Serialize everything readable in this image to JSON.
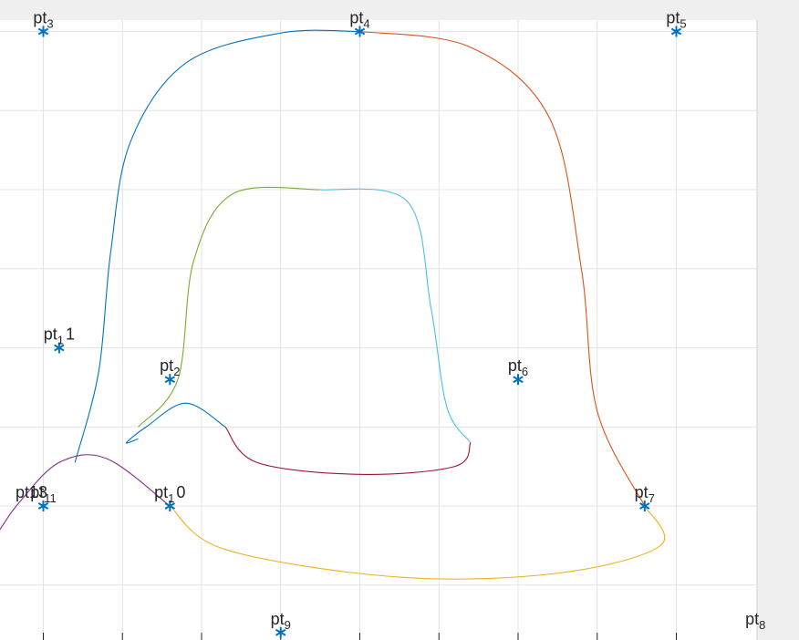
{
  "chart_data": {
    "type": "line",
    "title": "",
    "xlabel": "",
    "ylabel": "",
    "grid": true,
    "xlim": [
      -0.5,
      8.5
    ],
    "ylim": [
      -0.8,
      7.3
    ],
    "x_ticks": [
      0,
      1,
      2,
      3,
      4,
      5,
      6,
      7,
      8
    ],
    "y_ticks": [
      0,
      1,
      2,
      3,
      4,
      5,
      6,
      7
    ],
    "colors": {
      "background": "#f0f0f0",
      "axes": "#ffffff",
      "grid": "#e4e4e4",
      "marker": "#0072bd"
    },
    "points": [
      {
        "name": "pt",
        "sub": "3",
        "x": 0.0,
        "y": 7.0
      },
      {
        "name": "pt",
        "sub": "4",
        "x": 4.0,
        "y": 7.0
      },
      {
        "name": "pt",
        "sub": "5",
        "x": 8.0,
        "y": 7.0
      },
      {
        "name": "pt",
        "sub": "1",
        "prefix_extra": "1",
        "label_style": "plain",
        "text": "pt_1 1",
        "x": 0.2,
        "y": 3.0
      },
      {
        "name": "pt",
        "sub": "2",
        "x": 1.6,
        "y": 2.6
      },
      {
        "name": "pt",
        "sub": "6",
        "x": 6.0,
        "y": 2.6
      },
      {
        "name": "pt",
        "sub": "13",
        "text": "pt13",
        "x": 0.0,
        "y": 1.0
      },
      {
        "name": "pt",
        "sub": "11",
        "x": 0.0,
        "y": 1.0
      },
      {
        "name": "pt",
        "sub": "1",
        "text": "pt_1 0",
        "x": 1.6,
        "y": 1.0
      },
      {
        "name": "pt",
        "sub": "7",
        "x": 7.6,
        "y": 1.0
      },
      {
        "name": "pt",
        "sub": "9",
        "x": 3.0,
        "y": -0.6
      },
      {
        "name": "pt",
        "sub": "8",
        "x": 9.0,
        "y": -0.6,
        "marker_hidden": true
      }
    ],
    "labels": [
      {
        "text": "pt",
        "sub": "3",
        "x": 0.0,
        "y": 7.0
      },
      {
        "text": "pt",
        "sub": "4",
        "x": 4.0,
        "y": 7.0
      },
      {
        "text": "pt",
        "sub": "5",
        "x": 8.0,
        "y": 7.0
      },
      {
        "text": "pt",
        "sub": "1",
        "suffix": "1",
        "x": 0.2,
        "y": 3.0
      },
      {
        "text": "pt",
        "sub": "2",
        "x": 1.6,
        "y": 2.6
      },
      {
        "text": "pt",
        "sub": "6",
        "x": 6.0,
        "y": 2.6
      },
      {
        "text": "pt",
        "sub": "11",
        "x": 0.0,
        "y": 1.0
      },
      {
        "text": "pt13",
        "sub": "",
        "x": 0.0,
        "y": 1.0,
        "nudge": -0.15
      },
      {
        "text": "pt",
        "sub": "1",
        "suffix": "0",
        "x": 1.6,
        "y": 1.0
      },
      {
        "text": "pt",
        "sub": "7",
        "x": 7.6,
        "y": 1.0
      },
      {
        "text": "pt",
        "sub": "9",
        "x": 3.0,
        "y": -0.6
      },
      {
        "text": "pt",
        "sub": "8",
        "x": 9.0,
        "y": -0.6
      }
    ],
    "markers": [
      {
        "x": 0.0,
        "y": 7.0
      },
      {
        "x": 4.0,
        "y": 7.0
      },
      {
        "x": 8.0,
        "y": 7.0
      },
      {
        "x": 0.2,
        "y": 3.0
      },
      {
        "x": 1.6,
        "y": 2.6
      },
      {
        "x": 6.0,
        "y": 2.6
      },
      {
        "x": 0.0,
        "y": 1.0
      },
      {
        "x": 1.6,
        "y": 1.0
      },
      {
        "x": 7.6,
        "y": 1.0
      },
      {
        "x": 3.0,
        "y": -0.6
      }
    ],
    "series": [
      {
        "color": "#0072bd",
        "points": [
          [
            0.4,
            1.55
          ],
          [
            0.7,
            2.7
          ],
          [
            0.85,
            4.2
          ],
          [
            1.1,
            5.6
          ],
          [
            1.8,
            6.6
          ],
          [
            3.0,
            6.98
          ],
          [
            4.0,
            7.0
          ]
        ]
      },
      {
        "color": "#d95319",
        "points": [
          [
            4.0,
            7.0
          ],
          [
            5.4,
            6.8
          ],
          [
            6.4,
            5.9
          ],
          [
            6.8,
            4.0
          ],
          [
            7.0,
            2.2
          ],
          [
            7.6,
            1.0
          ]
        ]
      },
      {
        "color": "#edb120",
        "points": [
          [
            1.6,
            1.0
          ],
          [
            2.3,
            0.45
          ],
          [
            4.5,
            0.1
          ],
          [
            6.5,
            0.15
          ],
          [
            7.8,
            0.5
          ],
          [
            7.6,
            1.0
          ]
        ]
      },
      {
        "color": "#7e2f8e",
        "points": [
          [
            -0.55,
            0.7
          ],
          [
            -0.3,
            1.05
          ],
          [
            0.2,
            1.55
          ],
          [
            0.8,
            1.6
          ],
          [
            1.6,
            1.0
          ]
        ]
      },
      {
        "color": "#77ac30",
        "points": [
          [
            1.2,
            2.0
          ],
          [
            1.7,
            2.6
          ],
          [
            1.9,
            4.1
          ],
          [
            2.4,
            4.95
          ],
          [
            3.5,
            5.0
          ]
        ]
      },
      {
        "color": "#4dbeee",
        "points": [
          [
            3.5,
            5.0
          ],
          [
            4.6,
            4.85
          ],
          [
            4.9,
            3.5
          ],
          [
            5.1,
            2.25
          ],
          [
            5.4,
            1.8
          ]
        ]
      },
      {
        "color": "#a2142f",
        "points": [
          [
            2.3,
            2.0
          ],
          [
            2.7,
            1.55
          ],
          [
            4.0,
            1.4
          ],
          [
            5.2,
            1.5
          ],
          [
            5.4,
            1.8
          ]
        ]
      },
      {
        "color": "#0072bd",
        "points": [
          [
            1.2,
            1.85
          ],
          [
            1.05,
            1.8
          ],
          [
            1.3,
            2.0
          ],
          [
            1.8,
            2.3
          ],
          [
            2.3,
            2.0
          ]
        ]
      }
    ],
    "legend": "none"
  }
}
